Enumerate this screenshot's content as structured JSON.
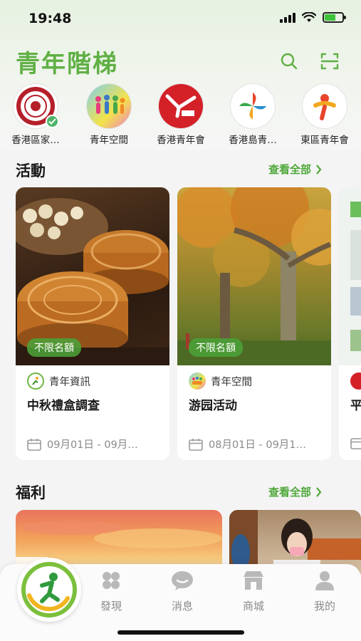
{
  "status_bar": {
    "time": "19:48"
  },
  "header": {
    "app_title": "青年階梯",
    "search_icon": "search-icon",
    "scan_icon": "scan-icon"
  },
  "organizations": [
    {
      "name": "香港區家…",
      "verified": true
    },
    {
      "name": "青年空間"
    },
    {
      "name": "香港青年會"
    },
    {
      "name": "香港島青…"
    },
    {
      "name": "東區青年會"
    }
  ],
  "activities": {
    "title": "活動",
    "see_all": "查看全部",
    "cards": [
      {
        "tag": "不限名額",
        "source": "青年資訊",
        "title": "中秋禮盒調查",
        "date": "09月01日 - 09月…"
      },
      {
        "tag": "不限名額",
        "source": "青年空間",
        "title": "游园活动",
        "date": "08月01日 - 09月1…"
      },
      {
        "title": "平"
      }
    ]
  },
  "welfare": {
    "title": "福利",
    "see_all": "查看全部"
  },
  "bottom_nav": {
    "items": [
      {
        "label": "發現",
        "icon": "discover-icon"
      },
      {
        "label": "消息",
        "icon": "message-icon"
      },
      {
        "label": "商城",
        "icon": "shop-icon"
      },
      {
        "label": "我的",
        "icon": "profile-icon"
      }
    ]
  },
  "colors": {
    "brand_green": "#5fb044",
    "tag_green": "#4ca038",
    "card_bg": "#ffffff"
  }
}
